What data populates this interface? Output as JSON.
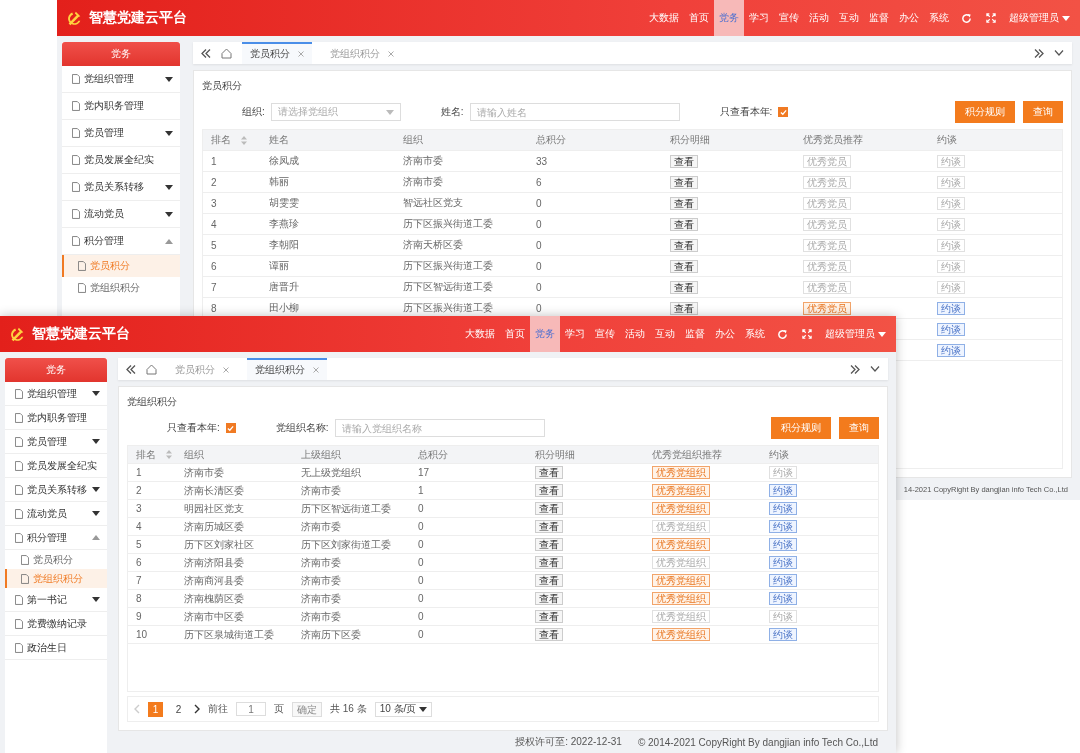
{
  "windows": [
    {
      "header": {
        "title": "智慧党建云平台",
        "nav": [
          {
            "label": "大数据",
            "selected": false
          },
          {
            "label": "首页",
            "selected": false
          },
          {
            "label": "党务",
            "selected": true
          },
          {
            "label": "学习",
            "selected": false
          },
          {
            "label": "宣传",
            "selected": false
          },
          {
            "label": "活动",
            "selected": false
          },
          {
            "label": "互动",
            "selected": false
          },
          {
            "label": "监督",
            "selected": false
          },
          {
            "label": "办公",
            "selected": false
          },
          {
            "label": "系统",
            "selected": false
          }
        ],
        "user": "超级管理员"
      },
      "sidebar": {
        "title": "党务",
        "items": [
          {
            "label": "党组织管理",
            "expanded": false
          },
          {
            "label": "党内职务管理"
          },
          {
            "label": "党员管理",
            "expanded": false
          },
          {
            "label": "党员发展全纪实"
          },
          {
            "label": "党员关系转移",
            "expanded": false
          },
          {
            "label": "流动党员",
            "expanded": false
          },
          {
            "label": "积分管理",
            "expanded": true,
            "children": [
              {
                "label": "党员积分",
                "selected": true
              },
              {
                "label": "党组织积分",
                "selected": false
              }
            ]
          }
        ]
      },
      "tabs": [
        {
          "label": "党员积分",
          "selected": true
        },
        {
          "label": "党组织积分",
          "selected": false
        }
      ],
      "panel": {
        "title": "党员积分",
        "filters": [
          {
            "kind": "select",
            "label": "组织:",
            "placeholder": "请选择党组织"
          },
          {
            "kind": "input",
            "label": "姓名:",
            "placeholder": "请输入姓名"
          },
          {
            "kind": "checkbox",
            "label": "只查看本年:",
            "checked": true
          }
        ],
        "buttons": [
          "积分规则",
          "查询"
        ],
        "table": {
          "columns": [
            {
              "label": "排名",
              "sortable": true
            },
            {
              "label": "姓名",
              "sortable": false
            },
            {
              "label": "组织",
              "sortable": false
            },
            {
              "label": "总积分",
              "sortable": false
            },
            {
              "label": "积分明细",
              "sortable": false
            },
            {
              "label": "优秀党员推荐",
              "sortable": false
            },
            {
              "label": "约谈",
              "sortable": false
            }
          ],
          "rows": [
            {
              "cells": [
                "1",
                "徐凤成",
                "济南市委",
                "33"
              ],
              "detail": "查看",
              "recommend": {
                "label": "优秀党员",
                "disabled": true
              },
              "talk": {
                "label": "约谈",
                "disabled": true
              }
            },
            {
              "cells": [
                "2",
                "韩丽",
                "济南市委",
                "6"
              ],
              "detail": "查看",
              "recommend": {
                "label": "优秀党员",
                "disabled": true
              },
              "talk": {
                "label": "约谈",
                "disabled": true
              }
            },
            {
              "cells": [
                "3",
                "胡雯雯",
                "智远社区党支",
                "0"
              ],
              "detail": "查看",
              "recommend": {
                "label": "优秀党员",
                "disabled": true
              },
              "talk": {
                "label": "约谈",
                "disabled": true
              }
            },
            {
              "cells": [
                "4",
                "李燕珍",
                "历下区振兴街道工委",
                "0"
              ],
              "detail": "查看",
              "recommend": {
                "label": "优秀党员",
                "disabled": true
              },
              "talk": {
                "label": "约谈",
                "disabled": true
              }
            },
            {
              "cells": [
                "5",
                "李朝阳",
                "济南天桥区委",
                "0"
              ],
              "detail": "查看",
              "recommend": {
                "label": "优秀党员",
                "disabled": true
              },
              "talk": {
                "label": "约谈",
                "disabled": true
              }
            },
            {
              "cells": [
                "6",
                "谭丽",
                "历下区振兴街道工委",
                "0"
              ],
              "detail": "查看",
              "recommend": {
                "label": "优秀党员",
                "disabled": true
              },
              "talk": {
                "label": "约谈",
                "disabled": true
              }
            },
            {
              "cells": [
                "7",
                "唐晋升",
                "历下区智远街道工委",
                "0"
              ],
              "detail": "查看",
              "recommend": {
                "label": "优秀党员",
                "disabled": true
              },
              "talk": {
                "label": "约谈",
                "disabled": true
              }
            },
            {
              "cells": [
                "8",
                "田小柳",
                "历下区振兴街道工委",
                "0"
              ],
              "detail": "查看",
              "recommend": {
                "label": "优秀党员",
                "disabled": false
              },
              "talk": {
                "label": "约谈",
                "disabled": false
              }
            },
            {
              "cells": [],
              "talk": {
                "label": "约谈",
                "disabled": false
              }
            },
            {
              "cells": [],
              "talk": {
                "label": "约谈",
                "disabled": false
              }
            }
          ]
        }
      },
      "footer": {
        "copyright": "14-2021 CopyRight By dangjian info Tech Co.,Ltd"
      }
    },
    {
      "header": {
        "title": "智慧党建云平台",
        "nav": [
          {
            "label": "大数据",
            "selected": false
          },
          {
            "label": "首页",
            "selected": false
          },
          {
            "label": "党务",
            "selected": true
          },
          {
            "label": "学习",
            "selected": false
          },
          {
            "label": "宣传",
            "selected": false
          },
          {
            "label": "活动",
            "selected": false
          },
          {
            "label": "互动",
            "selected": false
          },
          {
            "label": "监督",
            "selected": false
          },
          {
            "label": "办公",
            "selected": false
          },
          {
            "label": "系统",
            "selected": false
          }
        ],
        "user": "超级管理员"
      },
      "sidebar": {
        "title": "党务",
        "items": [
          {
            "label": "党组织管理",
            "expanded": false
          },
          {
            "label": "党内职务管理"
          },
          {
            "label": "党员管理",
            "expanded": false
          },
          {
            "label": "党员发展全纪实"
          },
          {
            "label": "党员关系转移",
            "expanded": false
          },
          {
            "label": "流动党员",
            "expanded": false
          },
          {
            "label": "积分管理",
            "expanded": true,
            "children": [
              {
                "label": "党员积分",
                "selected": false
              },
              {
                "label": "党组织积分",
                "selected": true
              }
            ]
          },
          {
            "label": "第一书记",
            "expanded": false
          },
          {
            "label": "党费缴纳记录"
          },
          {
            "label": "政治生日"
          }
        ]
      },
      "tabs": [
        {
          "label": "党员积分",
          "selected": false
        },
        {
          "label": "党组织积分",
          "selected": true
        }
      ],
      "panel": {
        "title": "党组织积分",
        "filters": [
          {
            "kind": "checkbox",
            "label": "只查看本年:",
            "checked": true
          },
          {
            "kind": "input",
            "label": "党组织名称:",
            "placeholder": "请输入党组织名称"
          }
        ],
        "buttons": [
          "积分规则",
          "查询"
        ],
        "table": {
          "columns": [
            {
              "label": "排名",
              "sortable": true
            },
            {
              "label": "组织",
              "sortable": false
            },
            {
              "label": "上级组织",
              "sortable": false
            },
            {
              "label": "总积分",
              "sortable": false
            },
            {
              "label": "积分明细",
              "sortable": false
            },
            {
              "label": "优秀党组织推荐",
              "sortable": false
            },
            {
              "label": "约谈",
              "sortable": false
            }
          ],
          "rows": [
            {
              "cells": [
                "1",
                "济南市委",
                "无上级党组织",
                "17"
              ],
              "detail": "查看",
              "recommend": {
                "label": "优秀党组织",
                "disabled": false
              },
              "talk": {
                "label": "约谈",
                "disabled": true
              }
            },
            {
              "cells": [
                "2",
                "济南长清区委",
                "济南市委",
                "1"
              ],
              "detail": "查看",
              "recommend": {
                "label": "优秀党组织",
                "disabled": false
              },
              "talk": {
                "label": "约谈",
                "disabled": false
              }
            },
            {
              "cells": [
                "3",
                "明园社区党支",
                "历下区智远街道工委",
                "0"
              ],
              "detail": "查看",
              "recommend": {
                "label": "优秀党组织",
                "disabled": false
              },
              "talk": {
                "label": "约谈",
                "disabled": false
              }
            },
            {
              "cells": [
                "4",
                "济南历城区委",
                "济南市委",
                "0"
              ],
              "detail": "查看",
              "recommend": {
                "label": "优秀党组织",
                "disabled": true
              },
              "talk": {
                "label": "约谈",
                "disabled": false
              }
            },
            {
              "cells": [
                "5",
                "历下区刘家社区",
                "历下区刘家街道工委",
                "0"
              ],
              "detail": "查看",
              "recommend": {
                "label": "优秀党组织",
                "disabled": false
              },
              "talk": {
                "label": "约谈",
                "disabled": false
              }
            },
            {
              "cells": [
                "6",
                "济南济阳县委",
                "济南市委",
                "0"
              ],
              "detail": "查看",
              "recommend": {
                "label": "优秀党组织",
                "disabled": true
              },
              "talk": {
                "label": "约谈",
                "disabled": false
              }
            },
            {
              "cells": [
                "7",
                "济南商河县委",
                "济南市委",
                "0"
              ],
              "detail": "查看",
              "recommend": {
                "label": "优秀党组织",
                "disabled": false
              },
              "talk": {
                "label": "约谈",
                "disabled": false
              }
            },
            {
              "cells": [
                "8",
                "济南槐荫区委",
                "济南市委",
                "0"
              ],
              "detail": "查看",
              "recommend": {
                "label": "优秀党组织",
                "disabled": false
              },
              "talk": {
                "label": "约谈",
                "disabled": false
              }
            },
            {
              "cells": [
                "9",
                "济南市中区委",
                "济南市委",
                "0"
              ],
              "detail": "查看",
              "recommend": {
                "label": "优秀党组织",
                "disabled": true
              },
              "talk": {
                "label": "约谈",
                "disabled": true
              }
            },
            {
              "cells": [
                "10",
                "历下区泉城街道工委",
                "济南历下区委",
                "0"
              ],
              "detail": "查看",
              "recommend": {
                "label": "优秀党组织",
                "disabled": false
              },
              "talk": {
                "label": "约谈",
                "disabled": false
              }
            }
          ]
        },
        "pagination": {
          "prev_disabled": true,
          "next_disabled": false,
          "pages": [
            {
              "label": "1",
              "selected": true
            },
            {
              "label": "2",
              "selected": false
            }
          ],
          "goto_label": "前往",
          "goto_value": "1",
          "page_unit": "页",
          "confirm": "确定",
          "total": "共 16 条",
          "page_size": "10 条/页"
        }
      },
      "footer": {
        "license": "授权许可至:  2022-12-31",
        "copyright": "© 2014-2021 CopyRight By dangjian info Tech Co.,Ltd"
      }
    }
  ]
}
